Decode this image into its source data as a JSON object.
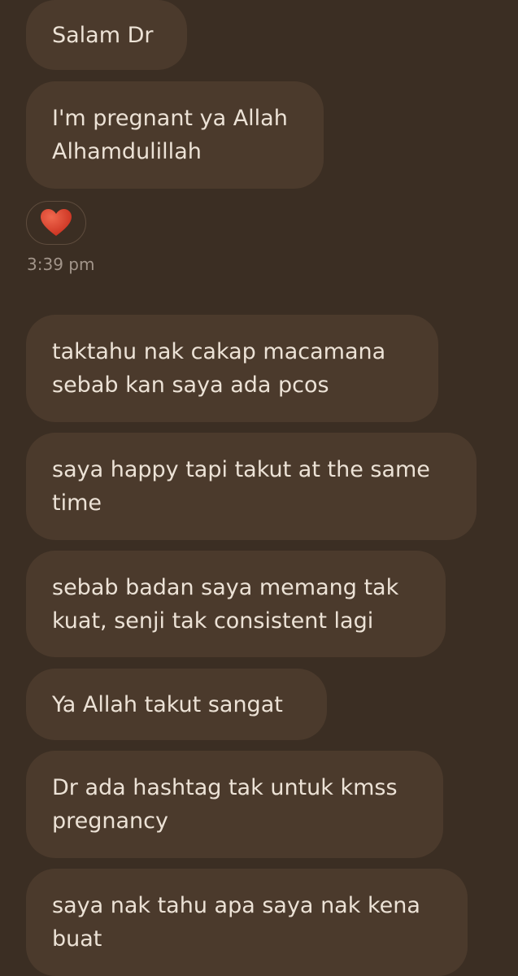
{
  "messages": [
    {
      "text": "Salam Dr"
    },
    {
      "text": "I'm pregnant ya Allah\nAlhamdulillah"
    },
    {
      "text": "taktahu nak cakap macamana\nsebab kan saya ada pcos"
    },
    {
      "text": "saya happy tapi takut at the same\ntime"
    },
    {
      "text": "sebab badan saya memang tak\nkuat, senji tak consistent lagi"
    },
    {
      "text": "Ya Allah takut sangat"
    },
    {
      "text": "Dr ada hashtag tak untuk kmss\npregnancy"
    },
    {
      "text": "saya nak tahu apa saya nak kena\nbuat"
    }
  ],
  "reaction": {
    "icon": "heart-icon",
    "color": "#d9432c"
  },
  "timestamp": "3:39 pm",
  "colors": {
    "background": "#3b2e23",
    "bubble": "#4b3a2c",
    "text": "#ece2d6",
    "muted": "#a2958a"
  }
}
